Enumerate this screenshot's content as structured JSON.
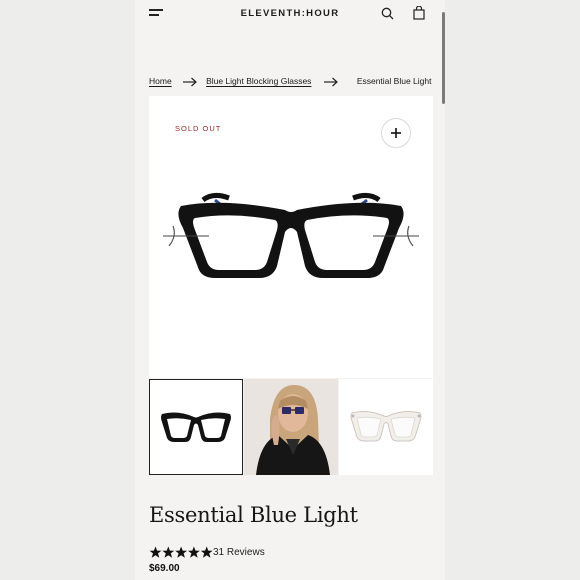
{
  "header": {
    "logo": "ELEVENTH:HOUR",
    "menu_icon": "hamburger-menu-icon",
    "search_icon": "search-icon",
    "cart_icon": "shopping-bag-icon"
  },
  "breadcrumb": {
    "items": [
      "Home",
      "Blue Light Blocking Glasses",
      "Essential Blue Light"
    ],
    "separator_icon": "arrow-right-icon"
  },
  "product": {
    "badge": "SOLD OUT",
    "zoom_icon": "plus-icon",
    "title": "Essential Blue Light",
    "rating_stars": 5,
    "reviews": "31 Reviews",
    "price": "$69.00",
    "thumbnails": [
      "black-frames-front",
      "model-wearing-glasses",
      "clear-frames-front"
    ]
  },
  "colors": {
    "badge": "#9a2a2a",
    "background": "#f4f3f1",
    "text": "#161616"
  }
}
